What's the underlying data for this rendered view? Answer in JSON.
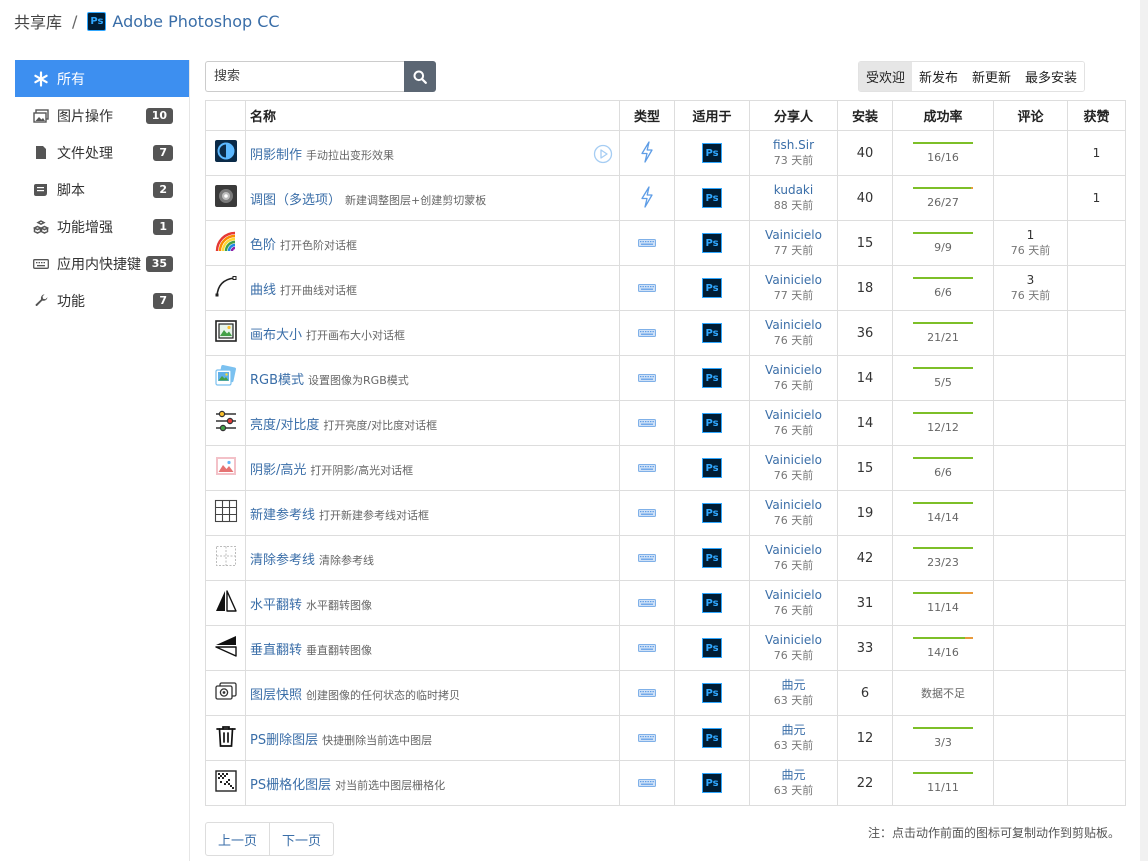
{
  "breadcrumb": {
    "root": "共享库",
    "separator": "/",
    "app": "Adobe Photoshop CC",
    "app_badge": "Ps"
  },
  "sidebar": {
    "items": [
      {
        "label": "所有",
        "icon": "asterisk-icon",
        "badge": ""
      },
      {
        "label": "图片操作",
        "icon": "images-icon",
        "badge": "10"
      },
      {
        "label": "文件处理",
        "icon": "file-icon",
        "badge": "7"
      },
      {
        "label": "脚本",
        "icon": "scroll-icon",
        "badge": "2"
      },
      {
        "label": "功能增强",
        "icon": "cubes-icon",
        "badge": "1"
      },
      {
        "label": "应用内快捷键",
        "icon": "keyboard-icon",
        "badge": "35"
      },
      {
        "label": "功能",
        "icon": "wrench-icon",
        "badge": "7"
      }
    ]
  },
  "search": {
    "placeholder": "搜索"
  },
  "sort_tabs": [
    "受欢迎",
    "新发布",
    "新更新",
    "最多安装"
  ],
  "table": {
    "headers": {
      "name": "名称",
      "type": "类型",
      "applies_to": "适用于",
      "sharer": "分享人",
      "installs": "安装",
      "success_rate": "成功率",
      "comments": "评论",
      "likes": "获赞"
    },
    "ps_badge": "Ps",
    "rows": [
      {
        "icon": "shadow-warp-icon",
        "title": "阴影制作",
        "desc": "手动拉出变形效果",
        "type": "lightning-icon",
        "play": true,
        "sharer": "fish.Sir",
        "time": "73 天前",
        "installs": "40",
        "rate_text": "16/16",
        "rate": 1.0,
        "comments": "",
        "comment_time": "",
        "likes": "1"
      },
      {
        "icon": "adjust-photo-icon",
        "title": "调图（多选项）",
        "desc": "新建调整图层+创建剪切蒙板",
        "type": "lightning-icon",
        "play": false,
        "sharer": "kudaki",
        "time": "88 天前",
        "installs": "40",
        "rate_text": "26/27",
        "rate": 0.963,
        "comments": "",
        "comment_time": "",
        "likes": "1"
      },
      {
        "icon": "levels-icon",
        "title": "色阶",
        "desc": "打开色阶对话框",
        "type": "keyboard-icon",
        "play": false,
        "sharer": "Vainicielo",
        "time": "77 天前",
        "installs": "15",
        "rate_text": "9/9",
        "rate": 1.0,
        "comments": "1",
        "comment_time": "76 天前",
        "likes": ""
      },
      {
        "icon": "curves-icon",
        "title": "曲线",
        "desc": "打开曲线对话框",
        "type": "keyboard-icon",
        "play": false,
        "sharer": "Vainicielo",
        "time": "77 天前",
        "installs": "18",
        "rate_text": "6/6",
        "rate": 1.0,
        "comments": "3",
        "comment_time": "76 天前",
        "likes": ""
      },
      {
        "icon": "canvas-size-icon",
        "title": "画布大小",
        "desc": "打开画布大小对话框",
        "type": "keyboard-icon",
        "play": false,
        "sharer": "Vainicielo",
        "time": "76 天前",
        "installs": "36",
        "rate_text": "21/21",
        "rate": 1.0,
        "comments": "",
        "comment_time": "",
        "likes": ""
      },
      {
        "icon": "rgb-mode-icon",
        "title": "RGB模式",
        "desc": "设置图像为RGB模式",
        "type": "keyboard-icon",
        "play": false,
        "sharer": "Vainicielo",
        "time": "76 天前",
        "installs": "14",
        "rate_text": "5/5",
        "rate": 1.0,
        "comments": "",
        "comment_time": "",
        "likes": ""
      },
      {
        "icon": "sliders-icon",
        "title": "亮度/对比度",
        "desc": "打开亮度/对比度对话框",
        "type": "keyboard-icon",
        "play": false,
        "sharer": "Vainicielo",
        "time": "76 天前",
        "installs": "14",
        "rate_text": "12/12",
        "rate": 1.0,
        "comments": "",
        "comment_time": "",
        "likes": ""
      },
      {
        "icon": "shadow-highlight-icon",
        "title": "阴影/高光",
        "desc": "打开阴影/高光对话框",
        "type": "keyboard-icon",
        "play": false,
        "sharer": "Vainicielo",
        "time": "76 天前",
        "installs": "15",
        "rate_text": "6/6",
        "rate": 1.0,
        "comments": "",
        "comment_time": "",
        "likes": ""
      },
      {
        "icon": "grid-icon",
        "title": "新建参考线",
        "desc": "打开新建参考线对话框",
        "type": "keyboard-icon",
        "play": false,
        "sharer": "Vainicielo",
        "time": "76 天前",
        "installs": "19",
        "rate_text": "14/14",
        "rate": 1.0,
        "comments": "",
        "comment_time": "",
        "likes": ""
      },
      {
        "icon": "clear-guides-icon",
        "title": "清除参考线",
        "desc": "清除参考线",
        "type": "keyboard-icon",
        "play": false,
        "sharer": "Vainicielo",
        "time": "76 天前",
        "installs": "42",
        "rate_text": "23/23",
        "rate": 1.0,
        "comments": "",
        "comment_time": "",
        "likes": ""
      },
      {
        "icon": "flip-horizontal-icon",
        "title": "水平翻转",
        "desc": "水平翻转图像",
        "type": "keyboard-icon",
        "play": false,
        "sharer": "Vainicielo",
        "time": "76 天前",
        "installs": "31",
        "rate_text": "11/14",
        "rate": 0.786,
        "comments": "",
        "comment_time": "",
        "likes": ""
      },
      {
        "icon": "flip-vertical-icon",
        "title": "垂直翻转",
        "desc": "垂直翻转图像",
        "type": "keyboard-icon",
        "play": false,
        "sharer": "Vainicielo",
        "time": "76 天前",
        "installs": "33",
        "rate_text": "14/16",
        "rate": 0.875,
        "comments": "",
        "comment_time": "",
        "likes": ""
      },
      {
        "icon": "snapshot-icon",
        "title": "图层快照",
        "desc": "创建图像的任何状态的临时拷贝",
        "type": "keyboard-icon",
        "play": false,
        "sharer": "曲元",
        "time": "63 天前",
        "installs": "6",
        "rate_text": "数据不足",
        "rate": null,
        "comments": "",
        "comment_time": "",
        "likes": ""
      },
      {
        "icon": "trash-icon",
        "title": "PS删除图层",
        "desc": "快捷删除当前选中图层",
        "type": "keyboard-icon",
        "play": false,
        "sharer": "曲元",
        "time": "63 天前",
        "installs": "12",
        "rate_text": "3/3",
        "rate": 1.0,
        "comments": "",
        "comment_time": "",
        "likes": ""
      },
      {
        "icon": "rasterize-icon",
        "title": "PS栅格化图层",
        "desc": "对当前选中图层栅格化",
        "type": "keyboard-icon",
        "play": false,
        "sharer": "曲元",
        "time": "63 天前",
        "installs": "22",
        "rate_text": "11/11",
        "rate": 1.0,
        "comments": "",
        "comment_time": "",
        "likes": ""
      }
    ]
  },
  "pager": {
    "prev": "上一页",
    "next": "下一页"
  },
  "footnote": "注：点击动作前面的图标可复制动作到剪贴板。",
  "colors": {
    "accent": "#3d8ff0",
    "link": "#3a6ea8",
    "success": "#7dbf28",
    "fail": "#e89a3c",
    "ps_bg": "#001d34",
    "ps_fg": "#31a8ff"
  }
}
